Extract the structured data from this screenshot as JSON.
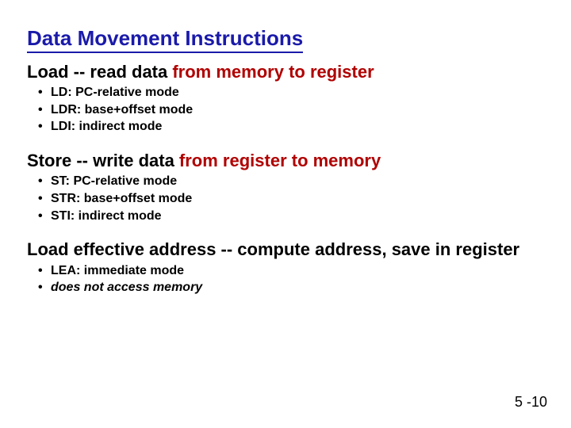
{
  "title": "Data Movement Instructions",
  "sections": [
    {
      "head_plain": "Load -- read data ",
      "head_accent": "from memory to register",
      "bullets": [
        {
          "text": "LD: PC-relative mode",
          "italic": false
        },
        {
          "text": "LDR: base+offset mode",
          "italic": false
        },
        {
          "text": "LDI: indirect mode",
          "italic": false
        }
      ]
    },
    {
      "head_plain": "Store -- write data ",
      "head_accent": "from register to memory",
      "bullets": [
        {
          "text": "ST: PC-relative mode",
          "italic": false
        },
        {
          "text": "STR: base+offset mode",
          "italic": false
        },
        {
          "text": "STI: indirect mode",
          "italic": false
        }
      ]
    },
    {
      "head_plain": "Load effective address -- compute address, save in register",
      "head_accent": "",
      "bullets": [
        {
          "text": "LEA: immediate mode",
          "italic": false
        },
        {
          "text": "does not access memory",
          "italic": true
        }
      ]
    }
  ],
  "page_number": "5 -10"
}
